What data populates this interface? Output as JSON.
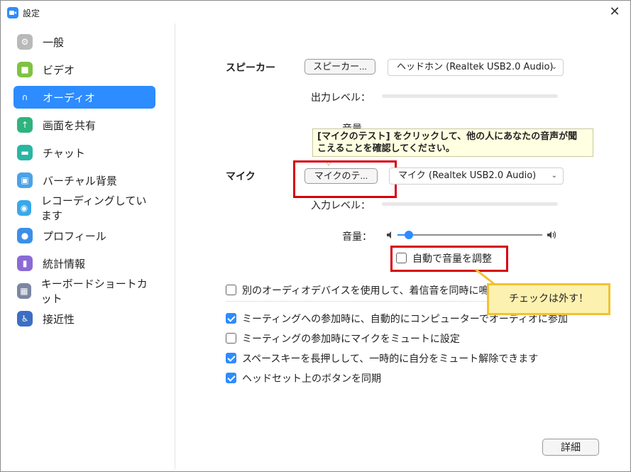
{
  "window": {
    "title": "設定",
    "close_glyph": "✕"
  },
  "sidebar": {
    "items": [
      {
        "label": "一般",
        "icon": "gear-icon",
        "color": "#b9b9b9"
      },
      {
        "label": "ビデオ",
        "icon": "video-camera-icon",
        "color": "#7fc241"
      },
      {
        "label": "オーディオ",
        "icon": "headphones-icon",
        "color": "#2d8cff"
      },
      {
        "label": "画面を共有",
        "icon": "share-screen-icon",
        "color": "#2fb37f"
      },
      {
        "label": "チャット",
        "icon": "chat-icon",
        "color": "#29b6a4"
      },
      {
        "label": "バーチャル背景",
        "icon": "virtual-background-icon",
        "color": "#4aa3e8"
      },
      {
        "label": "レコーディングしています",
        "icon": "record-icon",
        "color": "#38a9e9"
      },
      {
        "label": "プロフィール",
        "icon": "profile-icon",
        "color": "#3c8fe8"
      },
      {
        "label": "統計情報",
        "icon": "statistics-icon",
        "color": "#8b6ad6"
      },
      {
        "label": "キーボードショートカット",
        "icon": "keyboard-icon",
        "color": "#7c86a3"
      },
      {
        "label": "接近性",
        "icon": "accessibility-icon",
        "color": "#3c6fc4"
      }
    ],
    "active_index": 2
  },
  "speaker": {
    "heading": "スピーカー",
    "test_button": "スピーカー...",
    "device": "ヘッドホン (Realtek USB2.0 Audio)",
    "output_level_label": "出力レベル：",
    "volume_label_partial": "音量"
  },
  "tooltip": {
    "line1": "[マイクのテスト] をクリックして、他の人にあなたの音声が聞",
    "line2": "こえることを確認してください。"
  },
  "mic": {
    "heading": "マイク",
    "test_button": "マイクのテ...",
    "device": "マイク (Realtek USB2.0 Audio)",
    "input_level_label": "入力レベル：",
    "volume_label": "音量：",
    "volume_value": 0.08,
    "auto_adjust_label": "自動で音量を調整",
    "auto_adjust_checked": false
  },
  "callout": {
    "text": "チェックは外す！"
  },
  "options": [
    {
      "label": "別のオーディオデバイスを使用して、着信音を同時に鳴らします",
      "checked": false
    },
    {
      "label": "ミーティングへの参加時に、自動的にコンピューターでオーディオに参加",
      "checked": true
    },
    {
      "label": "ミーティングの参加時にマイクをミュートに設定",
      "checked": false
    },
    {
      "label": "スペースキーを長押しして、一時的に自分をミュート解除できます",
      "checked": true
    },
    {
      "label": "ヘッドセット上のボタンを同期",
      "checked": true
    }
  ],
  "details_button": "詳細",
  "colors": {
    "accent": "#2d8cff",
    "highlight_red": "#d8000c",
    "callout_border": "#f1c232"
  }
}
